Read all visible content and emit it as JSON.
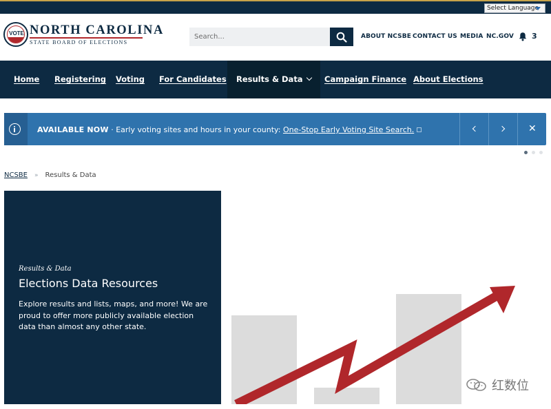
{
  "topbar": {
    "language_select": "Select Language"
  },
  "header": {
    "logo": {
      "badge_text": "VOTE",
      "title": "NORTH CAROLINA",
      "subtitle": "STATE BOARD OF ELECTIONS"
    },
    "search": {
      "placeholder": "Search...",
      "icon": "search-icon"
    },
    "utility_links": [
      "ABOUT NCSBE",
      "CONTACT US",
      "MEDIA",
      "NC.GOV"
    ],
    "notifications": {
      "icon": "bell-icon",
      "count": "3"
    }
  },
  "nav": {
    "items": [
      {
        "label": "Home"
      },
      {
        "label": "Registering"
      },
      {
        "label": "Voting"
      },
      {
        "label": "For Candidates"
      },
      {
        "label": "Results & Data",
        "active": true
      },
      {
        "label": "Campaign Finance"
      },
      {
        "label": "About Elections"
      }
    ]
  },
  "alert": {
    "icon": "info-icon",
    "label": "AVAILABLE NOW",
    "separator": "·",
    "message": "Early voting sites and hours in your county:",
    "link_text": "One-Stop Early Voting Site Search.",
    "colors": {
      "background": "#2f73ad",
      "icon_cell": "#265f92"
    }
  },
  "breadcrumb": {
    "home": "NCSBE",
    "separator": "»",
    "current": "Results & Data"
  },
  "hero": {
    "kicker": "Results & Data",
    "title": "Elections Data Resources",
    "description": "Explore results and lists, maps, and more! We are proud to offer more publicly available election data than almost any other state.",
    "colors": {
      "panel": "#0d2a42",
      "arrow": "#b0272b",
      "bars": "#dcdcdc"
    }
  },
  "watermark": {
    "text": "红数位",
    "icon": "wechat-icon"
  },
  "colors": {
    "navy": "#0d2a42",
    "accent_red": "#b0272b",
    "gold": "#c7a34a"
  }
}
